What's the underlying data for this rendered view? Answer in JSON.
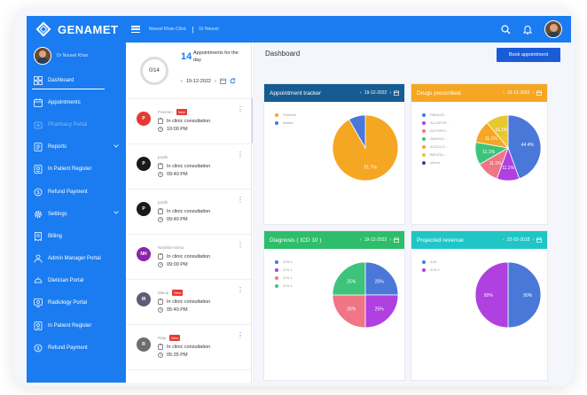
{
  "app": {
    "brand": "GENAMET"
  },
  "header": {
    "crumb_1": "Nouvel Khan Clinic",
    "crumb_2": "Dr Nouvel"
  },
  "sidebar": {
    "user_name": "Dr Nouvel Khan",
    "items": [
      {
        "label": "Dashboard",
        "icon": "grid-icon"
      },
      {
        "label": "Appointments",
        "icon": "calendar-icon"
      },
      {
        "label": "Pharmacy Portal",
        "icon": "pharmacy-icon"
      },
      {
        "label": "Reports",
        "icon": "reports-icon"
      },
      {
        "label": "In Patient Register",
        "icon": "register-icon"
      },
      {
        "label": "Refund Payment",
        "icon": "refund-icon"
      },
      {
        "label": "Settings",
        "icon": "gear-icon"
      },
      {
        "label": "Billing",
        "icon": "billing-icon"
      },
      {
        "label": "Admin Manager Portal",
        "icon": "admin-icon"
      },
      {
        "label": "Dietician Portal",
        "icon": "dietician-icon"
      },
      {
        "label": "Radiology Portal",
        "icon": "radiology-icon"
      },
      {
        "label": "In Patient Register",
        "icon": "register-icon"
      },
      {
        "label": "Refund Payment",
        "icon": "refund-icon"
      }
    ]
  },
  "appointments": {
    "ring_label": "0/14",
    "count": "14",
    "count_label": "Appointments for the day",
    "date": "19-12-2022",
    "list": [
      {
        "initials": "P",
        "color": "#e53935",
        "name": "Praveen",
        "badge": "New",
        "type": "In clinic consultation",
        "time": "10:00 PM"
      },
      {
        "initials": "P",
        "color": "#1a1a1a",
        "name": "prathi",
        "badge": "",
        "type": "In clinic consultation",
        "time": "09:40 PM"
      },
      {
        "initials": "P",
        "color": "#1a1a1a",
        "name": "prathi",
        "badge": "",
        "type": "In clinic consultation",
        "time": "09:40 PM"
      },
      {
        "initials": "NH",
        "color": "#8e24aa",
        "name": "Nasrilla Harisa",
        "badge": "",
        "type": "In clinic consultation",
        "time": "09:00 PM"
      },
      {
        "initials": "M",
        "color": "#5c5c7a",
        "name": "Manoj",
        "badge": "New",
        "type": "In clinic consultation",
        "time": "05:40 PM"
      },
      {
        "initials": "R",
        "color": "#6d6d6d",
        "name": "Raju",
        "badge": "New",
        "type": "In clinic consultation",
        "time": "05:35 PM"
      }
    ]
  },
  "main": {
    "title": "Dashboard",
    "book_label": "Book appointment",
    "widgets": [
      {
        "title": "Appointment tracker",
        "color": "#165c92",
        "date": "19-12-2022",
        "legend": [
          "Prebook",
          "Walkin"
        ],
        "chart_data": {
          "type": "pie",
          "categories": [
            "Prebook",
            "Walkin"
          ],
          "values": [
            91.7,
            8.3
          ],
          "colors": [
            "#f5a623",
            "#4a78d8"
          ],
          "labels": [
            "91.7%",
            ""
          ]
        }
      },
      {
        "title": "Drugs prescribed",
        "color": "#f5a623",
        "date": "19-12-2022",
        "legend": [
          "PARACE...",
          "ALLOPUR...",
          "AZITHRO...",
          "AMOXIC...",
          "ACECLO...",
          "BEFATA...",
          "others"
        ],
        "chart_data": {
          "type": "pie",
          "categories": [
            "PARACE...",
            "ALLOPUR...",
            "AZITHRO...",
            "AMOXIC...",
            "ACECLO...",
            "BEFATA...",
            "others"
          ],
          "values": [
            44.4,
            11.1,
            11.1,
            11.1,
            11.1,
            11.1,
            0
          ],
          "colors": [
            "#4a78d8",
            "#b040e0",
            "#f07585",
            "#3ec47a",
            "#f5a623",
            "#e8c830",
            "#5b2ea6"
          ],
          "labels": [
            "44.4%",
            "11.1%",
            "11.1%",
            "11.1%",
            "11.1%",
            "11.1%",
            ""
          ]
        }
      },
      {
        "title": "Diagnosis ( ICD 10 )",
        "color": "#2ebd6a",
        "date": "19-12-2022",
        "legend": [
          "A76.0",
          "A76.1",
          "A76.2",
          "A76.3"
        ],
        "chart_data": {
          "type": "pie",
          "categories": [
            "A76.0",
            "A76.1",
            "A76.2",
            "A76.3"
          ],
          "values": [
            25,
            25,
            25,
            25
          ],
          "colors": [
            "#4a78d8",
            "#b040e0",
            "#f07585",
            "#3ec47a"
          ],
          "labels": [
            "25%",
            "25%",
            "25%",
            "25%"
          ]
        }
      },
      {
        "title": "Projected revenue",
        "color": "#20c6c6",
        "date": "22-02-2018",
        "legend": [
          "A76",
          "A76.2"
        ],
        "chart_data": {
          "type": "pie",
          "categories": [
            "A76",
            "A76.2"
          ],
          "values": [
            50,
            50
          ],
          "colors": [
            "#4a78d8",
            "#b040e0"
          ],
          "labels": [
            "50%",
            "50%"
          ]
        }
      }
    ]
  }
}
